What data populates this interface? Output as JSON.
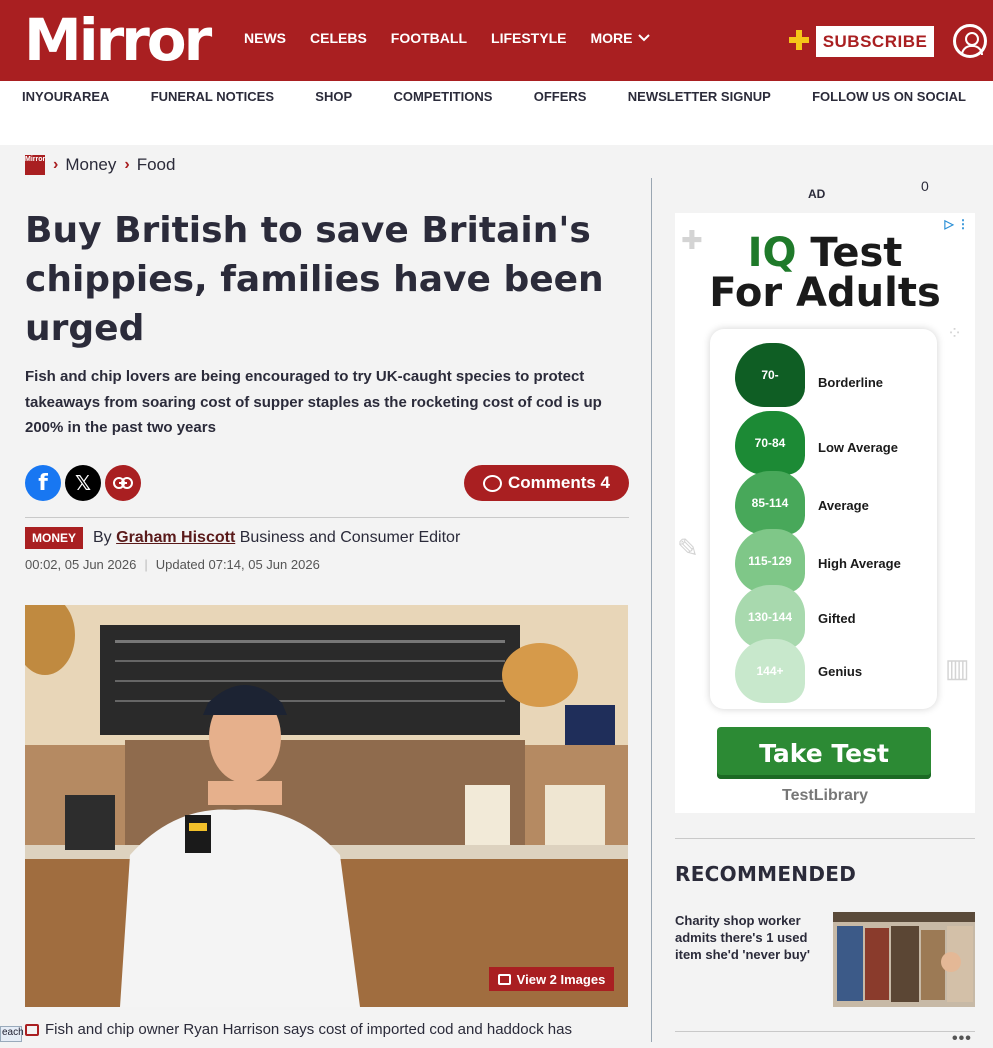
{
  "brand": {
    "logo_text": "Mirror",
    "bc_logo_text": "Mirror",
    "primary_color": "#a91f21"
  },
  "nav": {
    "items": [
      "NEWS",
      "CELEBS",
      "FOOTBALL",
      "LIFESTYLE"
    ],
    "more_label": "MORE",
    "subscribe_label": "SUBSCRIBE"
  },
  "subnav": [
    "INYOURAREA",
    "FUNERAL NOTICES",
    "SHOP",
    "COMPETITIONS",
    "OFFERS",
    "NEWSLETTER SIGNUP",
    "FOLLOW US ON SOCIAL"
  ],
  "breadcrumb": [
    "Money",
    "Food"
  ],
  "article": {
    "headline": "Buy British to save Britain's chippies, families have been urged",
    "standfirst": "Fish and chip lovers are being encouraged to try UK-caught species to protect takeaways from soaring cost of supper staples as the rocketing cost of cod is up 200% in the past two years",
    "comments_label": "Comments 4",
    "section_badge": "MONEY",
    "by_prefix": "By",
    "author": "Graham Hiscott",
    "author_role": "Business and Consumer Editor",
    "published": "00:02, 05 Jun 2026",
    "updated": "Updated 07:14, 05 Jun 2026",
    "view_images_label": "View 2 Images",
    "caption": "Fish and chip owner Ryan Harrison says cost of imported cod and haddock has"
  },
  "share": {
    "facebook": "f",
    "x": "𝕏",
    "link": "⊂⊃"
  },
  "ad": {
    "label": "AD",
    "count": "0",
    "title_highlight": "IQ",
    "title_rest": "Test",
    "title_line2": "For Adults",
    "tiers": [
      {
        "range": "70-",
        "label": "Borderline",
        "color": "#0f5e24"
      },
      {
        "range": "70-84",
        "label": "Low Average",
        "color": "#1c8a35"
      },
      {
        "range": "85-114",
        "label": "Average",
        "color": "#48a85a"
      },
      {
        "range": "115-129",
        "label": "High Average",
        "color": "#7fc788"
      },
      {
        "range": "130-144",
        "label": "Gifted",
        "color": "#a8d9ae"
      },
      {
        "range": "144+",
        "label": "Genius",
        "color": "#c8e8cc"
      }
    ],
    "cta": "Take Test",
    "advertiser": "TestLibrary"
  },
  "recommended": {
    "title": "RECOMMENDED",
    "item_text": "Charity shop worker admits there's 1 used item she'd 'never buy'",
    "more": "•••"
  },
  "taskbar_fragment": "each"
}
